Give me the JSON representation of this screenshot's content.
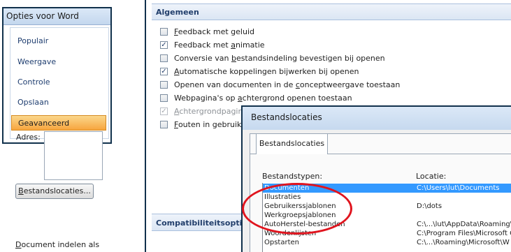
{
  "left_panel": {
    "title": "Opties voor Word",
    "items": [
      {
        "label": "Populair"
      },
      {
        "label": "Weergave"
      },
      {
        "label": "Controle"
      },
      {
        "label": "Opslaan"
      },
      {
        "label": "Geavanceerd",
        "selected": true
      }
    ]
  },
  "main": {
    "section_title": "Algemeen",
    "options": [
      {
        "pre": "",
        "key": "F",
        "post": "eedback met geluid",
        "checked": false,
        "disabled": false
      },
      {
        "pre": "Feedback met ",
        "key": "a",
        "post": "nimatie",
        "checked": true,
        "disabled": false
      },
      {
        "pre": "Conversie van ",
        "key": "b",
        "post": "estandsindeling bevestigen bij openen",
        "checked": false,
        "disabled": false
      },
      {
        "pre": "",
        "key": "A",
        "post": "utomatische koppelingen bijwerken bij openen",
        "checked": true,
        "disabled": false
      },
      {
        "pre": "Openen van documenten in de ",
        "key": "c",
        "post": "onceptweergave toestaan",
        "checked": false,
        "disabled": false
      },
      {
        "pre": "Webpagina's op ",
        "key": "a",
        "post": "chtergrond openen toestaan",
        "checked": false,
        "disabled": false
      },
      {
        "pre": "",
        "key": "A",
        "post": "chtergrondpagine",
        "checked": true,
        "disabled": true
      },
      {
        "pre": "",
        "key": "F",
        "post": "outen in gebruiker",
        "checked": false,
        "disabled": false
      }
    ],
    "adres_label": "Adres:",
    "file_locations_button": {
      "key": "B",
      "rest": "estandslocaties..."
    },
    "compat_section_title": "Compatibiliteitsopties vo",
    "doc_layout_label": {
      "key": "D",
      "rest": "ocument indelen als of"
    }
  },
  "dialog": {
    "title": "Bestandslocaties",
    "tab_label": "Bestandslocaties",
    "col_type_header": "Bestandstypen:",
    "col_location_header": "Locatie:",
    "rows": [
      {
        "type": "Documenten",
        "location": "C:\\Users\\lut\\Documents",
        "selected": true
      },
      {
        "type": "Illustraties",
        "location": "",
        "selected": false
      },
      {
        "type": "Gebruikerssjablonen",
        "location": "D:\\dots",
        "selected": false
      },
      {
        "type": "Werkgroepsjablonen",
        "location": "",
        "selected": false
      },
      {
        "type": "AutoHerstel-bestanden",
        "location": "C:\\...\\lut\\AppData\\Roaming\\",
        "selected": false
      },
      {
        "type": "Woordenlijsten",
        "location": "C:\\Program Files\\Microsoft C",
        "selected": false
      },
      {
        "type": "Opstarten",
        "location": "C:\\...\\Roaming\\Microsoft\\W",
        "selected": false
      }
    ]
  },
  "colors": {
    "selection_orange": "#f7a53e",
    "dialog_selection_blue": "#3399ff",
    "annotation_red": "#e0141e",
    "header_text": "#213e6b"
  }
}
